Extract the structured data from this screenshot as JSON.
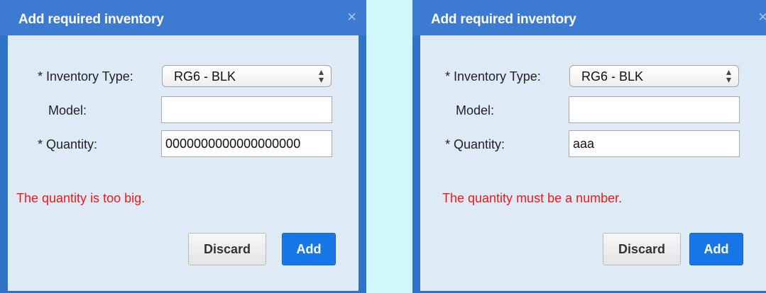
{
  "dialogs": [
    {
      "title": "Add required inventory",
      "close_icon": "close-icon",
      "inventory_type_label": "* Inventory Type:",
      "inventory_type_value": "RG6 - BLK",
      "model_label": "Model:",
      "model_value": "",
      "quantity_label": "* Quantity:",
      "quantity_value": "0000000000000000000",
      "error_message": "The quantity is too big.",
      "discard_label": "Discard",
      "add_label": "Add"
    },
    {
      "title": "Add required inventory",
      "close_icon": "close-icon",
      "inventory_type_label": "* Inventory Type:",
      "inventory_type_value": "RG6 - BLK",
      "model_label": "Model:",
      "model_value": "",
      "quantity_label": "* Quantity:",
      "quantity_value": "aaa",
      "error_message": "The quantity must be a number.",
      "discard_label": "Discard",
      "add_label": "Add"
    }
  ],
  "colors": {
    "page_background": "#d2f7fb",
    "titlebar": "#3d7bd3",
    "dialog_body": "#deeaf5",
    "error_text": "#f01818",
    "add_button": "#1777e6"
  }
}
